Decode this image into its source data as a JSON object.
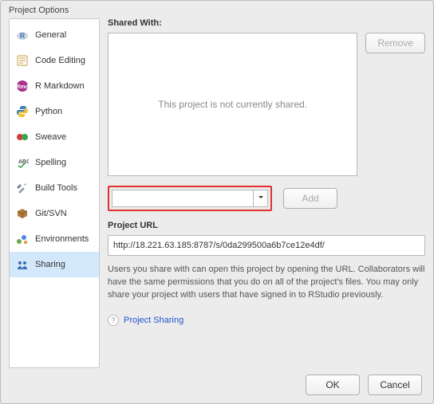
{
  "window": {
    "title": "Project Options"
  },
  "sidebar": {
    "items": [
      {
        "label": "General"
      },
      {
        "label": "Code Editing"
      },
      {
        "label": "R Markdown"
      },
      {
        "label": "Python"
      },
      {
        "label": "Sweave"
      },
      {
        "label": "Spelling"
      },
      {
        "label": "Build Tools"
      },
      {
        "label": "Git/SVN"
      },
      {
        "label": "Environments"
      },
      {
        "label": "Sharing"
      }
    ]
  },
  "main": {
    "shared_with_label": "Shared With:",
    "shared_empty_text": "This project is not currently shared.",
    "remove_label": "Remove",
    "add_label": "Add",
    "combo_value": "",
    "project_url_label": "Project URL",
    "project_url_value": "http://18.221.63.185:8787/s/0da299500a6b7ce12e4df/",
    "help_text": "Users you share with can open this project by opening the URL. Collaborators will have the same permissions that you do on all of the project's files. You may only share your project with users that have signed in to RStudio previously.",
    "help_link_label": "Project Sharing"
  },
  "footer": {
    "ok_label": "OK",
    "cancel_label": "Cancel"
  }
}
